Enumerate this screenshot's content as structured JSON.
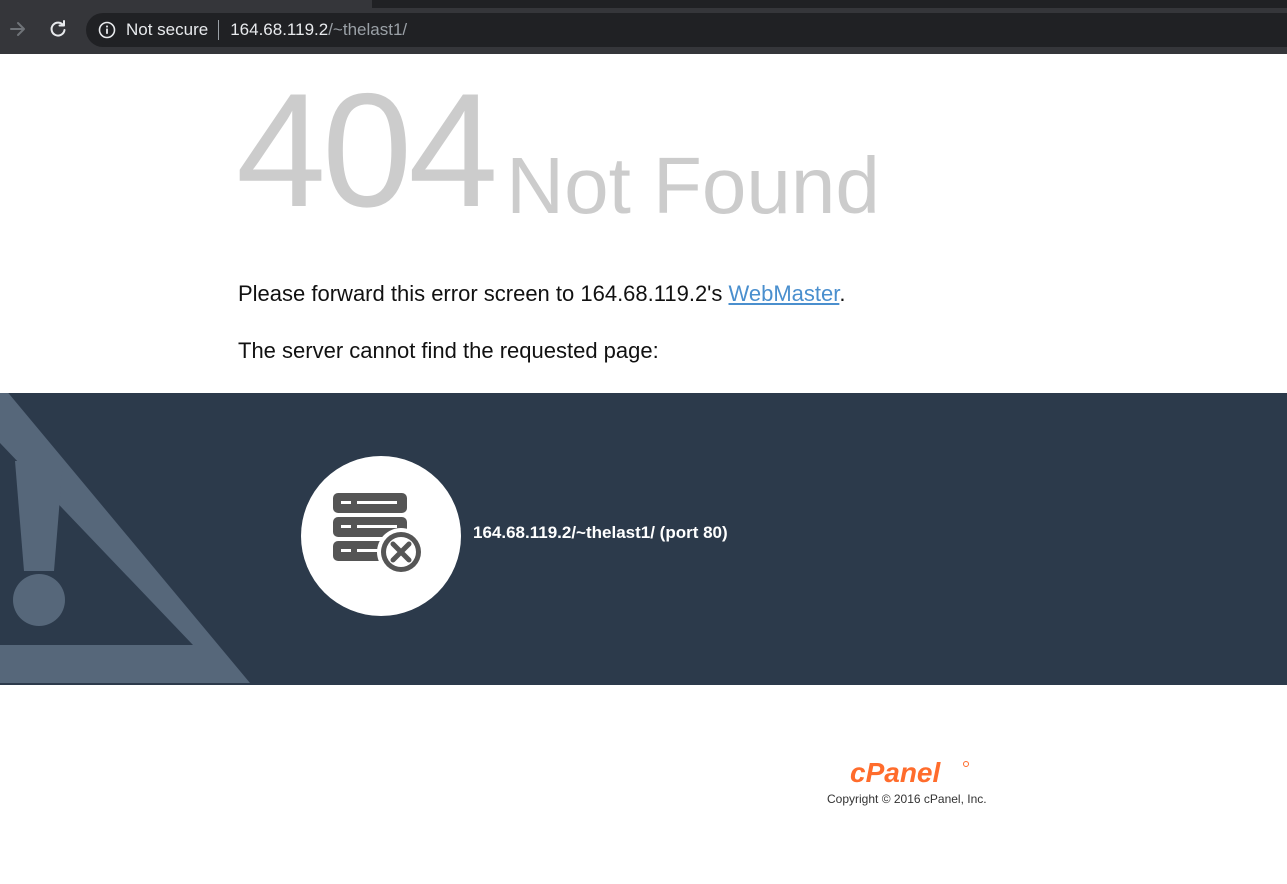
{
  "browser": {
    "security_label": "Not secure",
    "url_host": "164.68.119.2",
    "url_path": "/~thelast1/"
  },
  "error": {
    "code": "404",
    "title": "Not Found",
    "forward_prefix": "Please forward this error screen to 164.68.119.2's ",
    "webmaster_link": "WebMaster",
    "forward_suffix": ".",
    "server_message": "The server cannot find the requested page:",
    "requested_url": "164.68.119.2/~thelast1/ (port 80)"
  },
  "footer": {
    "logo_text": "cPanel",
    "copyright": "Copyright © 2016 cPanel, Inc."
  },
  "colors": {
    "band": "#2c3a4b",
    "faded_text": "#cccccc",
    "link": "#4a8fce",
    "cpanel_orange": "#ff6c2c"
  }
}
